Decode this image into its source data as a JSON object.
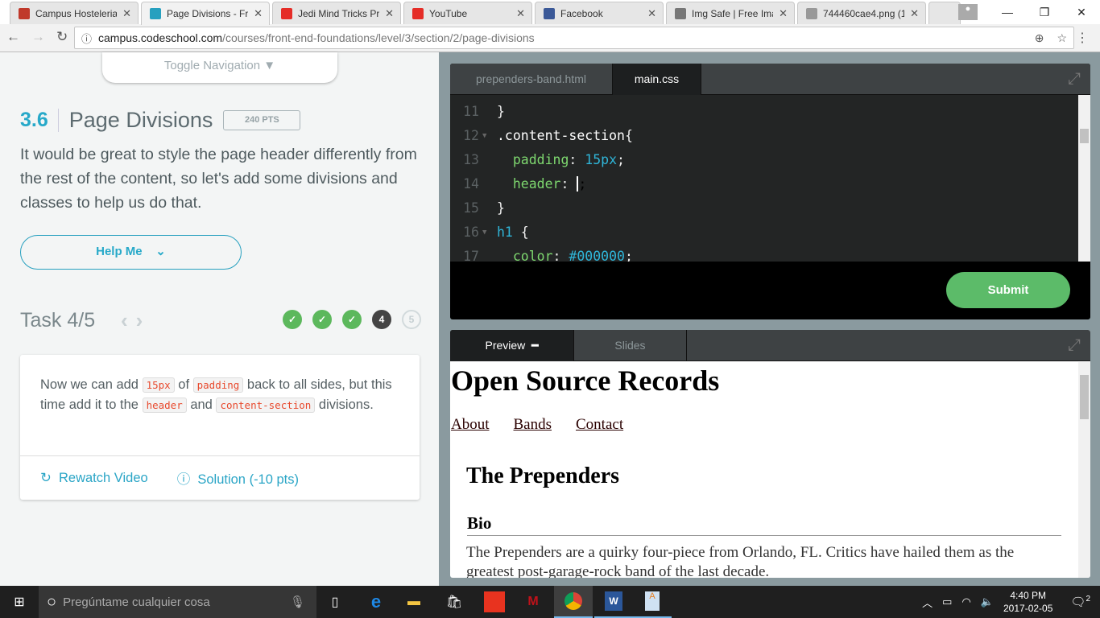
{
  "browser": {
    "tabs": [
      {
        "title": "Campus Hosteleria",
        "icon": "checkmark-logo-icon",
        "color": "#c0392b"
      },
      {
        "title": "Page Divisions - Front",
        "icon": "code-brackets-icon",
        "color": "#27a0bf",
        "active": true
      },
      {
        "title": "Jedi Mind Tricks Pre",
        "icon": "youtube-icon",
        "color": "#e52d27"
      },
      {
        "title": "YouTube",
        "icon": "youtube-icon",
        "color": "#e52d27"
      },
      {
        "title": "Facebook",
        "icon": "facebook-icon",
        "color": "#3b5998"
      },
      {
        "title": "Img Safe | Free Ima",
        "icon": "imgsafe-icon",
        "color": "#777777"
      },
      {
        "title": "744460cae4.png (1",
        "icon": "file-icon",
        "color": "#999999"
      }
    ],
    "url_host": "campus.codeschool.com",
    "url_path": "/courses/front-end-foundations/level/3/section/2/page-divisions"
  },
  "lesson": {
    "toggle_nav": "Toggle Navigation",
    "number": "3.6",
    "title": "Page Divisions",
    "points": "240 PTS",
    "description": "It would be great to style the page header differently from the rest of the content, so let's add some divisions and classes to help us do that.",
    "help": "Help Me",
    "task": "Task 4/5",
    "steps": [
      "done",
      "done",
      "done",
      "4",
      "5"
    ],
    "instruction": {
      "t1": "Now we can add ",
      "c1": "15px",
      "t2": " of ",
      "c2": "padding",
      "t3": " back to all sides, but this time add it to the ",
      "c3": "header",
      "t4": " and ",
      "c4": "content-section",
      "t5": " divisions."
    },
    "rewatch": "Rewatch Video",
    "solution": "Solution (-10 pts)"
  },
  "editor": {
    "tabs": [
      "prependers-band.html",
      "main.css"
    ],
    "active_tab": "main.css",
    "lines": [
      {
        "n": "11",
        "fold": false,
        "tokens": [
          [
            "k-p",
            "}"
          ]
        ]
      },
      {
        "n": "12",
        "fold": true,
        "tokens": [
          [
            "k-sel",
            ".content-section"
          ],
          [
            "k-p",
            "{"
          ]
        ]
      },
      {
        "n": "13",
        "fold": false,
        "tokens": [
          [
            "k-p",
            "  "
          ],
          [
            "k-prop",
            "padding"
          ],
          [
            "k-p",
            ": "
          ],
          [
            "k-val",
            "15px"
          ],
          [
            "k-p",
            ";"
          ]
        ]
      },
      {
        "n": "14",
        "fold": false,
        "tokens": [
          [
            "k-p",
            "  "
          ],
          [
            "k-prop",
            "header"
          ],
          [
            "k-p",
            ": "
          ],
          [
            "caret",
            ";"
          ]
        ]
      },
      {
        "n": "15",
        "fold": false,
        "tokens": [
          [
            "k-p",
            "}"
          ]
        ]
      },
      {
        "n": "16",
        "fold": true,
        "tokens": [
          [
            "k-tag",
            "h1"
          ],
          [
            "k-p",
            " {"
          ]
        ]
      },
      {
        "n": "17",
        "fold": false,
        "tokens": [
          [
            "k-p",
            "  "
          ],
          [
            "k-prop",
            "color"
          ],
          [
            "k-p",
            ": "
          ],
          [
            "k-val",
            "#000000"
          ],
          [
            "k-p",
            ";"
          ]
        ]
      }
    ],
    "submit": "Submit"
  },
  "preview": {
    "tabs": [
      "Preview",
      "Slides"
    ],
    "h1": "Open Source Records",
    "nav": [
      "About",
      "Bands",
      "Contact"
    ],
    "h2": "The Prependers",
    "h3": "Bio",
    "p": "The Prependers are a quirky four-piece from Orlando, FL. Critics have hailed them as the greatest post-garage-rock band of the last decade."
  },
  "taskbar": {
    "search": "Pregúntame cualquier cosa",
    "time": "4:40 PM",
    "date": "2017-02-05",
    "notifications": "2"
  }
}
